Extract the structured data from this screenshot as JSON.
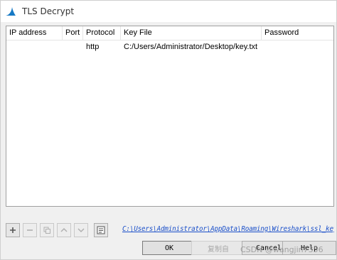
{
  "window": {
    "title": "TLS Decrypt",
    "icon": "wireshark-fin-icon",
    "accent": "#1679c5"
  },
  "table": {
    "columns": [
      "IP address",
      "Port",
      "Protocol",
      "Key File",
      "Password"
    ],
    "rows": [
      {
        "ip": "",
        "port": "",
        "protocol": "http",
        "key_file": "C:/Users/Administrator/Desktop/key.txt",
        "password": ""
      }
    ]
  },
  "toolbar": {
    "add_icon": "plus-icon",
    "remove_icon": "minus-icon",
    "copy_icon": "copy-icon",
    "up_icon": "arrow-up-icon",
    "down_icon": "arrow-down-icon",
    "browse_icon": "folder-list-icon",
    "config_path": "C:\\Users\\Administrator\\AppData\\Roaming\\Wireshark\\ssl_keys"
  },
  "buttons": {
    "ok": "OK",
    "copy": "复制自",
    "cancel": "Cancel",
    "help": "Help"
  },
  "watermark": "CSDN @wangjin7356"
}
